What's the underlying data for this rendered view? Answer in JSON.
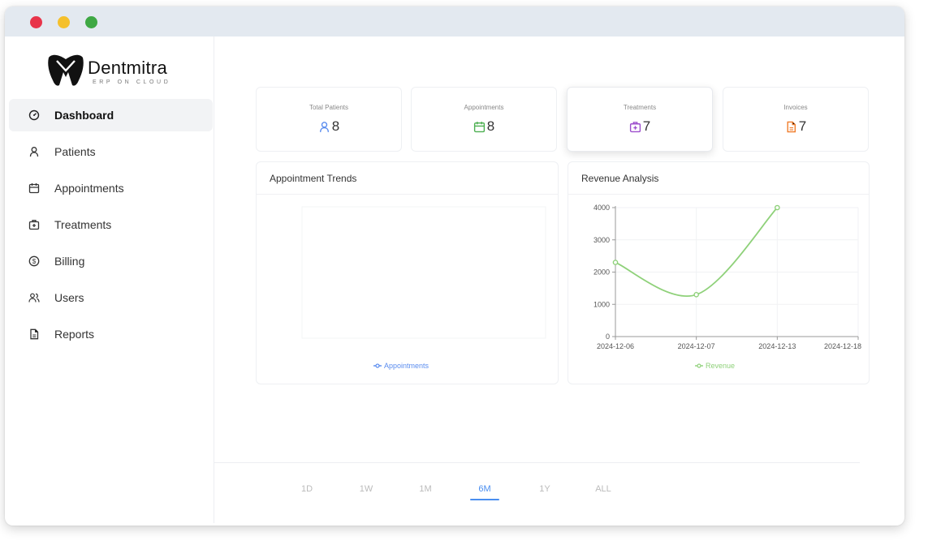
{
  "brand": {
    "name": "Dentmitra",
    "tagline": "ERP ON CLOUD"
  },
  "sidebar": {
    "items": [
      {
        "label": "Dashboard",
        "icon": "gauge-icon",
        "active": true
      },
      {
        "label": "Patients",
        "icon": "person-icon",
        "active": false
      },
      {
        "label": "Appointments",
        "icon": "calendar-icon",
        "active": false
      },
      {
        "label": "Treatments",
        "icon": "medical-kit-icon",
        "active": false
      },
      {
        "label": "Billing",
        "icon": "dollar-coin-icon",
        "active": false
      },
      {
        "label": "Users",
        "icon": "users-icon",
        "active": false
      },
      {
        "label": "Reports",
        "icon": "document-icon",
        "active": false
      }
    ]
  },
  "stats": [
    {
      "label": "Total Patients",
      "value": "8",
      "icon": "person-icon",
      "color": "#5b8def"
    },
    {
      "label": "Appointments",
      "value": "8",
      "icon": "calendar-icon",
      "color": "#4caf50"
    },
    {
      "label": "Treatments",
      "value": "7",
      "icon": "medical-kit-icon",
      "color": "#9c4dcc"
    },
    {
      "label": "Invoices",
      "value": "7",
      "icon": "document-icon",
      "color": "#f07c2a"
    }
  ],
  "charts": {
    "appointments": {
      "title": "Appointment Trends",
      "legend": "Appointments",
      "color": "#5b8def"
    },
    "revenue": {
      "title": "Revenue Analysis",
      "legend": "Revenue",
      "color": "#8fd17a"
    }
  },
  "chart_data": [
    {
      "type": "line",
      "title": "Appointment Trends",
      "series": [
        {
          "name": "Appointments",
          "values": []
        }
      ],
      "categories": []
    },
    {
      "type": "line",
      "title": "Revenue Analysis",
      "categories": [
        "2024-12-06",
        "2024-12-07",
        "2024-12-13",
        "2024-12-18"
      ],
      "series": [
        {
          "name": "Revenue",
          "values": [
            2300,
            1300,
            4000,
            null
          ]
        }
      ],
      "yticks": [
        0,
        1000,
        2000,
        3000,
        4000
      ],
      "ylim": [
        0,
        4000
      ],
      "grid": true,
      "legend": "bottom-center"
    }
  ],
  "time_ranges": {
    "options": [
      "1D",
      "1W",
      "1M",
      "6M",
      "1Y",
      "ALL"
    ],
    "selected": "6M"
  }
}
